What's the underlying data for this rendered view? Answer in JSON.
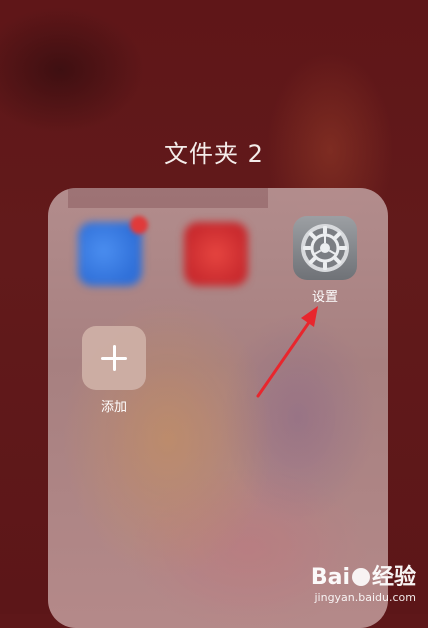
{
  "folder": {
    "title": "文件夹 2"
  },
  "apps": [
    {
      "id": "blurred-blue-app",
      "label": ""
    },
    {
      "id": "blurred-red-app",
      "label": ""
    },
    {
      "id": "settings",
      "label": "设置",
      "icon": "gear-icon"
    },
    {
      "id": "add",
      "label": "添加",
      "icon": "plus-icon"
    }
  ],
  "annotation": {
    "arrow_color": "#e8262d"
  },
  "watermark": {
    "brand": "Bai du 经验",
    "url": "jingyan.baidu.com"
  }
}
